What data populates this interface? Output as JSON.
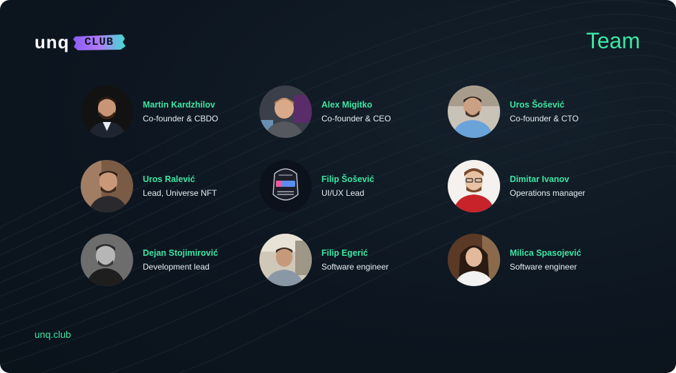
{
  "brand": {
    "wordmark": "unq",
    "badge": "CLUB"
  },
  "title": "Team",
  "members": [
    {
      "name": "Martin Kardzhilov",
      "role": "Co-founder & CBDO"
    },
    {
      "name": "Alex Migitko",
      "role": "Co-founder & CEO"
    },
    {
      "name": "Uros Šošević",
      "role": "Co-founder & CTO"
    },
    {
      "name": "Uros Ralević",
      "role": "Lead, Universe NFT"
    },
    {
      "name": "Filip Šošević",
      "role": "UI/UX Lead"
    },
    {
      "name": "Dimitar Ivanov",
      "role": "Operations manager"
    },
    {
      "name": "Dejan Stojimirović",
      "role": "Development lead"
    },
    {
      "name": "Filip Egerić",
      "role": "Software engineer"
    },
    {
      "name": "Milica Spasojević",
      "role": "Software engineer"
    }
  ],
  "footer": {
    "site": "unq.club"
  },
  "colors": {
    "accent": "#3de6a3",
    "background": "#0d1620",
    "text": "#e8eef3"
  }
}
